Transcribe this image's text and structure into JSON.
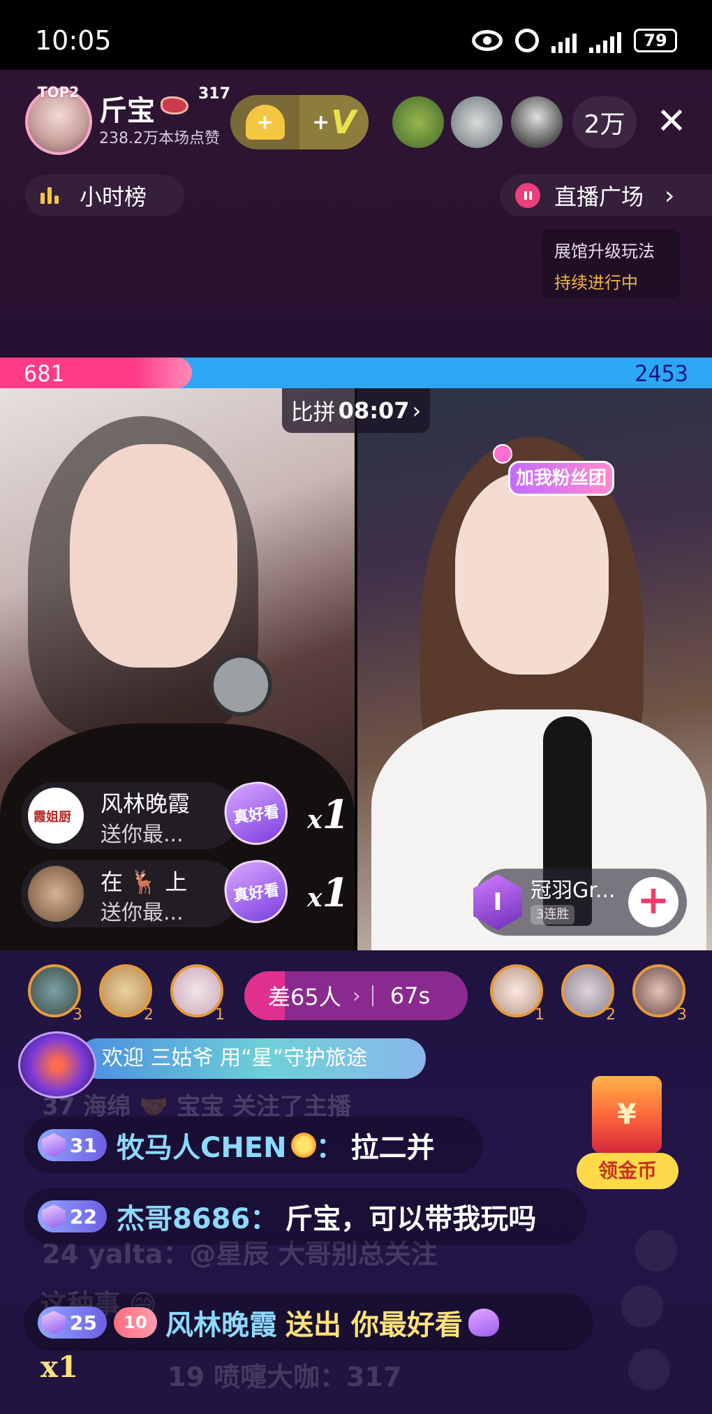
{
  "status_bar": {
    "time": "10:05",
    "battery": "79",
    "icons": [
      "eye-icon",
      "alarm-icon",
      "signal-icon",
      "signal-icon",
      "battery-icon"
    ]
  },
  "host": {
    "rank_badge": "TOP2",
    "name": "斤宝",
    "badge_number": "317",
    "likes": "238.2万本场点赞",
    "viewer_count": "2万",
    "vip_plus": "+",
    "vip_letter": "V",
    "heart_plus": "+"
  },
  "nav": {
    "hour_rank": "小时榜",
    "live_square": "直播广场",
    "live_square_chevron": "›",
    "close": "✕"
  },
  "exhibit": {
    "line1": "展馆升级玩法",
    "line2": "持续进行中"
  },
  "pk": {
    "left_score": "681",
    "right_score": "2453",
    "left_share_percent": 27,
    "timer_label": "比拼",
    "timer_value": "08:07",
    "timer_chevron": "›",
    "status_gap": "差65人",
    "status_chevron": "›",
    "status_seconds": "67s",
    "colors": {
      "left": "#ff3b86",
      "right": "#2ba7f5"
    }
  },
  "video": {
    "fan_club": "加我粉丝团",
    "guest_badge": "I",
    "guest_name": "冠羽Gr...",
    "guest_streak": "3连胜",
    "follow": "+"
  },
  "gifts": [
    {
      "avatar_text": "霞姐厨",
      "user": "风林晚霞",
      "desc": "送你最...",
      "gift": "真好看",
      "count_prefix": "x",
      "count": "1"
    },
    {
      "avatar_text": "",
      "user": "在 🦌 上",
      "desc": "送你最...",
      "gift": "真好看",
      "count_prefix": "x",
      "count": "1"
    }
  ],
  "supporters": {
    "left": [
      "3",
      "2",
      "1"
    ],
    "right": [
      "1",
      "2",
      "3"
    ]
  },
  "welcome": "欢迎 三姑爷 用“星”守护旅途",
  "chat": {
    "ghost_top": "37  海绵 🤝 宝宝 关注了主播",
    "lines": [
      {
        "level": "31",
        "name": "牧马人CHEN",
        "sep": "：",
        "text": "拉二并"
      },
      {
        "level": "22",
        "name": "杰哥8686",
        "sep": "：",
        "text": "斤宝，可以带我玩吗"
      }
    ],
    "ghost_mid": "24  yalta：@星辰 大哥别总关注",
    "ghost_mid2": "这种事 😅",
    "gift_line": {
      "level": "25",
      "fan_level": "10",
      "name": "风林晚霞",
      "action": "送出 你最好看"
    },
    "ghost_bottom": "19  喷嚏大咖：317",
    "gift_mult": "x1"
  },
  "coin_widget": {
    "chest": "¥",
    "label": "领金币"
  }
}
